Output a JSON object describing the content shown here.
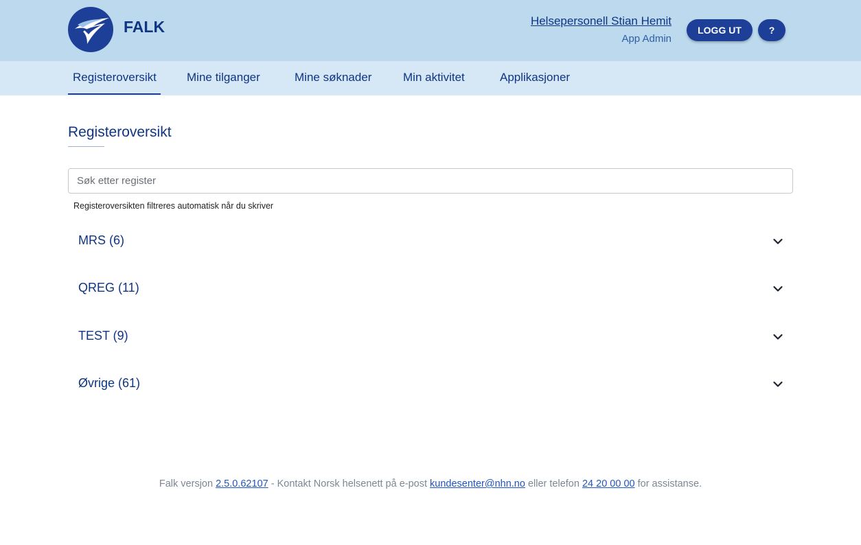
{
  "header": {
    "app_name": "FALK",
    "user_name": "Helsepersonell Stian Hemit",
    "user_role": "App Admin",
    "logout_label": "LOGG UT",
    "help_label": "?"
  },
  "nav": {
    "items": [
      {
        "label": "Registeroversikt",
        "active": true
      },
      {
        "label": "Mine tilganger"
      },
      {
        "label": "Mine søknader"
      },
      {
        "label": "Min aktivitet"
      },
      {
        "label": "Applikasjoner"
      }
    ]
  },
  "main": {
    "title": "Registeroversikt",
    "search_placeholder": "Søk etter register",
    "search_value": "",
    "hint": "Registeroversikten filtreres automatisk når du skriver",
    "groups": [
      {
        "label": "MRS (6)"
      },
      {
        "label": "QREG (11)"
      },
      {
        "label": "TEST (9)"
      },
      {
        "label": "Øvrige (61)"
      }
    ]
  },
  "footer": {
    "prefix": "Falk versjon ",
    "version": "2.5.0.62107",
    "middle": " - Kontakt Norsk helsenett på e-post ",
    "email": "kundesenter@nhn.no",
    "phone_prefix": " eller telefon ",
    "phone": "24 20 00 00",
    "suffix": " for assistanse."
  },
  "colors": {
    "header_bg": "#bcd9ee",
    "nav_bg": "#d6e7f5",
    "brand_blue": "#1d3f97",
    "link_blue": "#1f55c2"
  },
  "icons": {
    "logo": "falk-bird-logo",
    "group_toggle": "chevron-down-icon"
  }
}
